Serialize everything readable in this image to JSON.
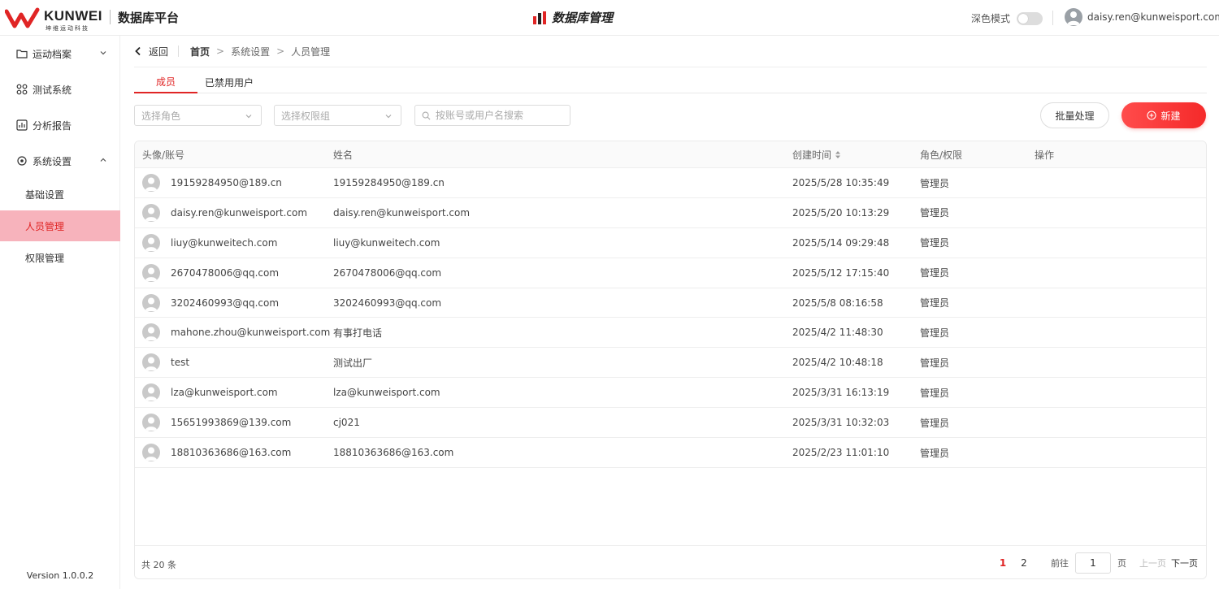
{
  "header": {
    "logo_text": "KUNWEI",
    "logo_subtext": "坤维运动科技",
    "platform_title": "数据库平台",
    "center_title": "数据库管理",
    "dark_mode_label": "深色模式",
    "user_email": "daisy.ren@kunweisport.com",
    "colors": {
      "brand": "#e02525"
    }
  },
  "sidebar": {
    "items": [
      {
        "label": "运动档案",
        "icon": "folder-icon"
      },
      {
        "label": "测试系统",
        "icon": "grid-icon"
      },
      {
        "label": "分析报告",
        "icon": "chart-icon"
      },
      {
        "label": "系统设置",
        "icon": "settings-icon"
      }
    ],
    "sub_items": [
      {
        "label": "基础设置"
      },
      {
        "label": "人员管理"
      },
      {
        "label": "权限管理"
      }
    ],
    "version": "Version 1.0.0.2"
  },
  "breadcrumb": {
    "back_label": "返回",
    "items": [
      "首页",
      "系统设置",
      "人员管理"
    ]
  },
  "tabs": [
    {
      "label": "成员"
    },
    {
      "label": "已禁用用户"
    }
  ],
  "filters": {
    "role_placeholder": "选择角色",
    "perm_group_placeholder": "选择权限组",
    "search_placeholder": "按账号或用户名搜索"
  },
  "actions": {
    "batch_label": "批量处理",
    "new_label": "新建"
  },
  "table": {
    "columns": [
      "头像/账号",
      "姓名",
      "创建时间",
      "角色/权限",
      "操作"
    ],
    "rows": [
      {
        "account": "19159284950@189.cn",
        "name": "19159284950@189.cn",
        "created": "2025/5/28 10:35:49",
        "role": "管理员"
      },
      {
        "account": "daisy.ren@kunweisport.com",
        "name": "daisy.ren@kunweisport.com",
        "created": "2025/5/20 10:13:29",
        "role": "管理员"
      },
      {
        "account": "liuy@kunweitech.com",
        "name": "liuy@kunweitech.com",
        "created": "2025/5/14 09:29:48",
        "role": "管理员"
      },
      {
        "account": "2670478006@qq.com",
        "name": "2670478006@qq.com",
        "created": "2025/5/12 17:15:40",
        "role": "管理员"
      },
      {
        "account": "3202460993@qq.com",
        "name": "3202460993@qq.com",
        "created": "2025/5/8 08:16:58",
        "role": "管理员"
      },
      {
        "account": "mahone.zhou@kunweisport.com",
        "name": "有事打电话",
        "created": "2025/4/2 11:48:30",
        "role": "管理员"
      },
      {
        "account": "test",
        "name": "测试出厂",
        "created": "2025/4/2 10:48:18",
        "role": "管理员"
      },
      {
        "account": "lza@kunweisport.com",
        "name": "lza@kunweisport.com",
        "created": "2025/3/31 16:13:19",
        "role": "管理员"
      },
      {
        "account": "15651993869@139.com",
        "name": "cj021",
        "created": "2025/3/31 10:32:03",
        "role": "管理员"
      },
      {
        "account": "18810363686@163.com",
        "name": "18810363686@163.com",
        "created": "2025/2/23 11:01:10",
        "role": "管理员"
      }
    ]
  },
  "pagination": {
    "total_text": "共 20 条",
    "pages": [
      "1",
      "2"
    ],
    "goto_label": "前往",
    "goto_value": "1",
    "page_suffix": "页",
    "prev_label": "上一页",
    "next_label": "下一页"
  }
}
